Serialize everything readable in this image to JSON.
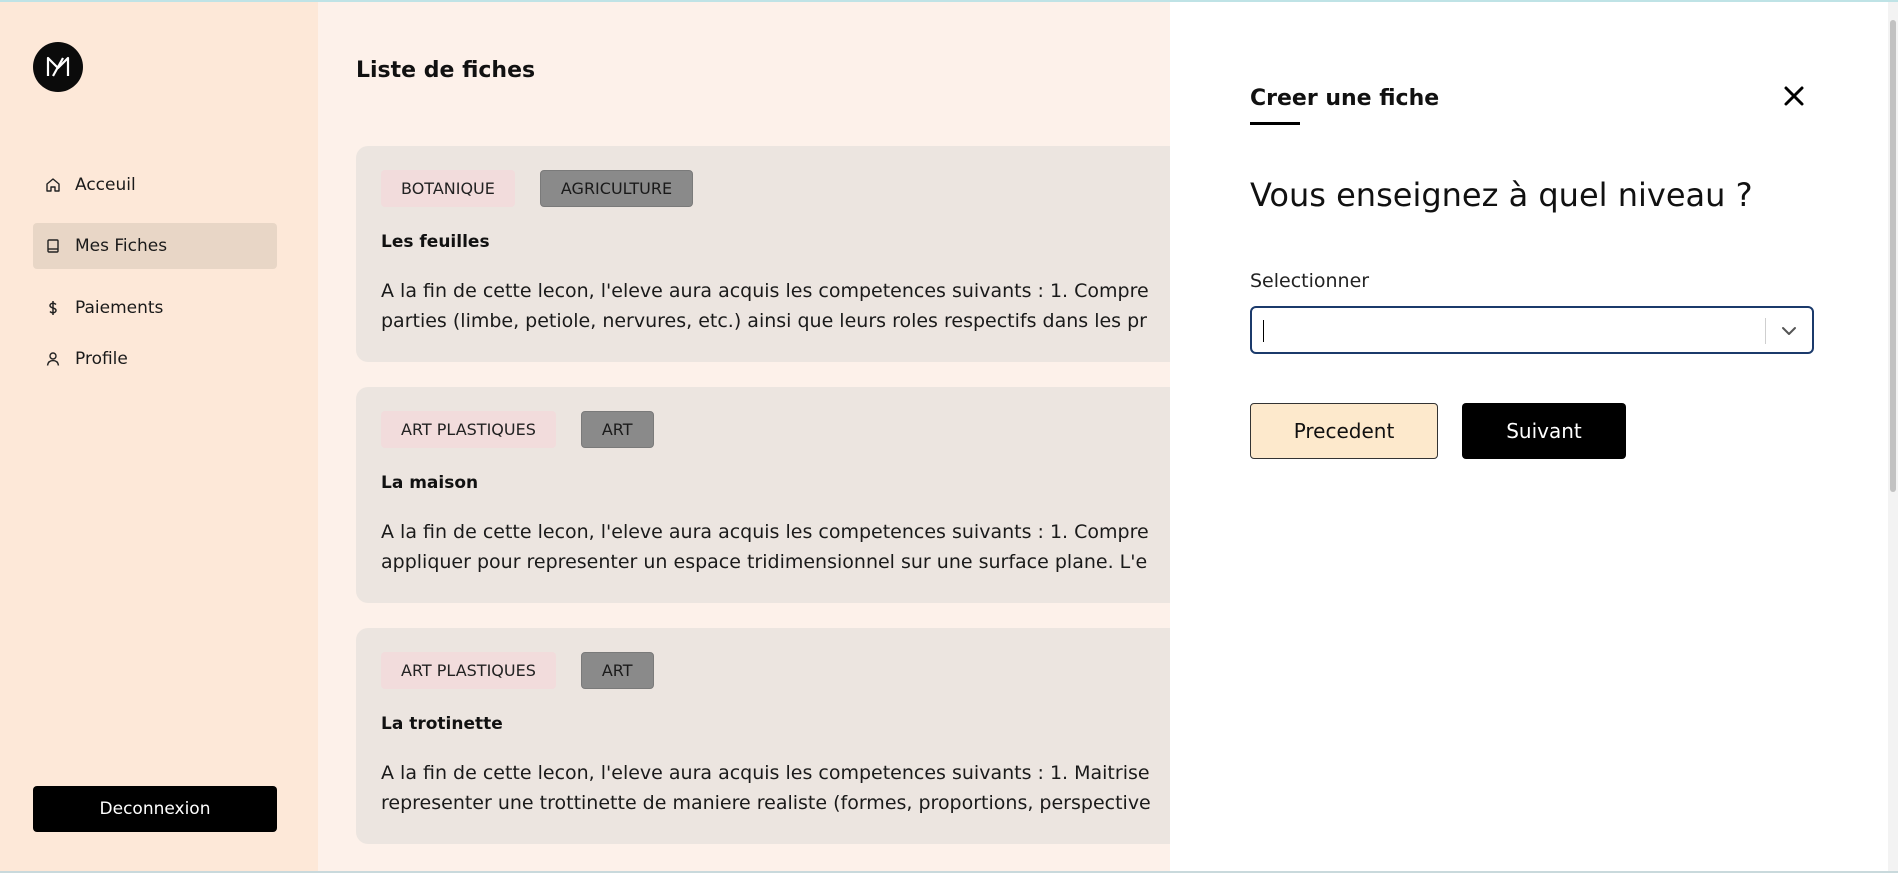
{
  "sidebar": {
    "logo_icon": "m-logo-icon",
    "items": [
      {
        "label": "Acceuil",
        "icon": "home-icon",
        "active": false
      },
      {
        "label": "Mes Fiches",
        "icon": "book-icon",
        "active": true
      },
      {
        "label": "Paiements",
        "icon": "dollar-icon",
        "active": false
      },
      {
        "label": "Profile",
        "icon": "user-icon",
        "active": false
      }
    ],
    "logout_label": "Deconnexion"
  },
  "main": {
    "title": "Liste de fiches",
    "cards": [
      {
        "tags": [
          "BOTANIQUE",
          "AGRICULTURE"
        ],
        "title": "Les feuilles",
        "desc_line1": "A la fin de cette lecon, l'eleve aura acquis les competences suivants : 1. Compre",
        "desc_line2": "parties (limbe, petiole, nervures, etc.) ainsi que leurs roles respectifs dans les pr"
      },
      {
        "tags": [
          "ART PLASTIQUES",
          "ART"
        ],
        "title": "La maison",
        "desc_line1": "A la fin de cette lecon, l'eleve aura acquis les competences suivants : 1. Compre",
        "desc_line2": "appliquer pour representer un espace tridimensionnel sur une surface plane. L'e"
      },
      {
        "tags": [
          "ART PLASTIQUES",
          "ART"
        ],
        "title": "La trotinette",
        "desc_line1": "A la fin de cette lecon, l'eleve aura acquis les competences suivants : 1. Maitrise",
        "desc_line2": "representer une trottinette de maniere realiste (formes, proportions, perspective"
      }
    ]
  },
  "drawer": {
    "title": "Creer une fiche",
    "close_icon": "close-icon",
    "question": "Vous enseignez à quel niveau ?",
    "select_label": "Selectionner",
    "select_value": "",
    "prev_label": "Precedent",
    "next_label": "Suivant"
  },
  "colors": {
    "sidebar_bg": "#fde8d8",
    "active_item_bg": "#e8d6c6",
    "card_bg": "#ece5e0",
    "subject_tag_bg": "#f2dcdc",
    "domain_tag_bg": "#8a8a8a",
    "select_border": "#1b3a6b",
    "prev_button_bg": "#fde9cc",
    "primary": "#000000"
  }
}
